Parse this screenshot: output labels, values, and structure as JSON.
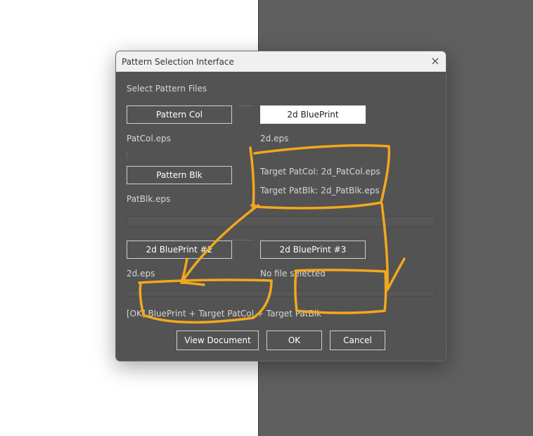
{
  "dialog": {
    "title": "Pattern Selection Interface",
    "close_icon": "×",
    "section_label": "Select Pattern Files",
    "buttons": {
      "pattern_col": "Pattern Col",
      "blueprint": "2d BluePrint",
      "pattern_blk": "Pattern Blk",
      "blueprint2": "2d BluePrint #2",
      "blueprint3": "2d BluePrint #3"
    },
    "files": {
      "pattern_col": "PatCol.eps",
      "blueprint": "2d.eps",
      "pattern_blk": "PatBlk.eps",
      "blueprint2": "2d.eps",
      "blueprint3": "No file selected"
    },
    "targets": {
      "patcol": "Target PatCol: 2d_PatCol.eps",
      "patblk": "Target PatBlk: 2d_PatBlk.eps"
    },
    "status": "[OK] BluePrint  + Target PatCol  + Target PatBlk",
    "footer": {
      "view_document": "View Document",
      "ok": "OK",
      "cancel": "Cancel"
    }
  },
  "colors": {
    "dialog_bg": "#535353",
    "annotation": "#f2a81d",
    "right_backdrop": "#5f5f5f"
  }
}
